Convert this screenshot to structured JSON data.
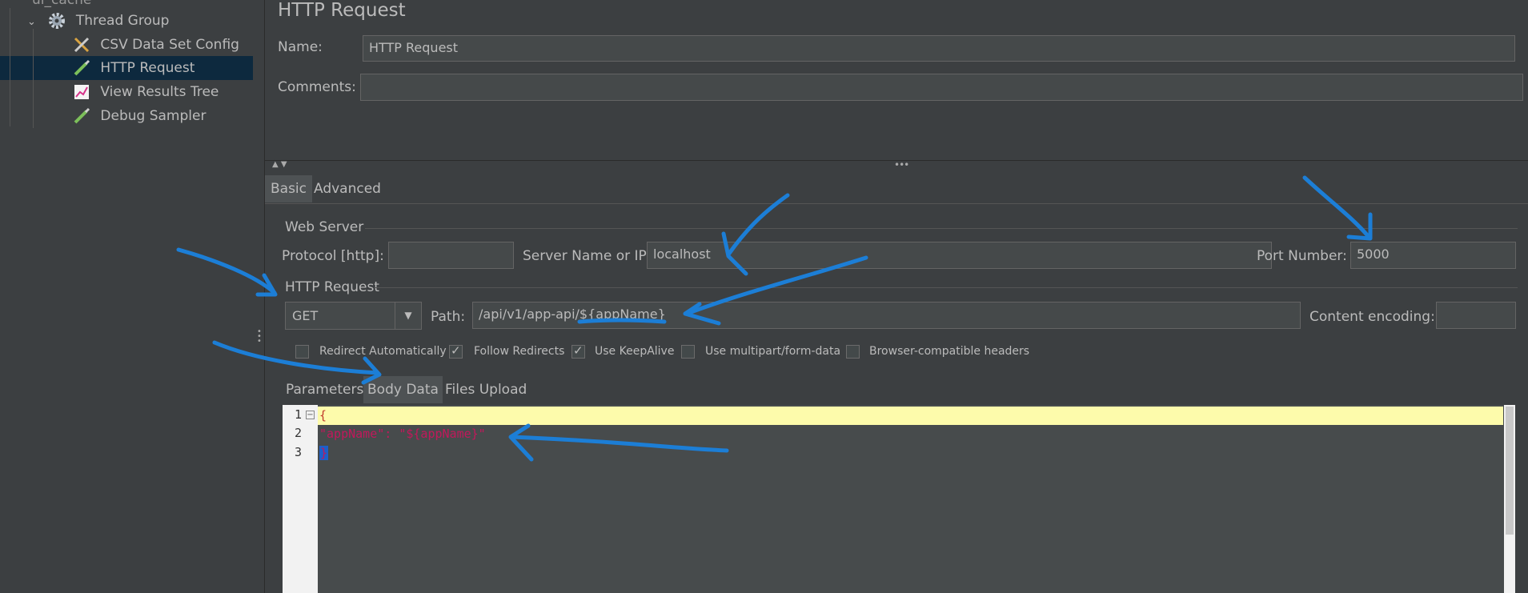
{
  "tree": {
    "top_partial": "ul_cache",
    "items": [
      {
        "label": "Thread Group",
        "icon": "gear-icon"
      },
      {
        "label": "CSV Data Set Config",
        "icon": "tools-icon"
      },
      {
        "label": "HTTP Request",
        "icon": "pipette-icon"
      },
      {
        "label": "View Results Tree",
        "icon": "chart-icon"
      },
      {
        "label": "Debug Sampler",
        "icon": "pipette-icon"
      }
    ]
  },
  "main": {
    "title": "HTTP Request",
    "name_label": "Name:",
    "name_value": "HTTP Request",
    "comments_label": "Comments:",
    "comments_value": "",
    "tabs": [
      {
        "label": "Basic"
      },
      {
        "label": "Advanced"
      }
    ],
    "web_server": {
      "title": "Web Server",
      "protocol_label": "Protocol [http]:",
      "protocol_value": "",
      "server_label": "Server Name or IP:",
      "server_value": "localhost",
      "port_label": "Port Number:",
      "port_value": "5000"
    },
    "http_request": {
      "title": "HTTP Request",
      "method": "GET",
      "path_label": "Path:",
      "path_value": "/api/v1/app-api/${appName}",
      "encoding_label": "Content encoding:",
      "encoding_value": ""
    },
    "checkboxes": [
      {
        "label": "Redirect Automatically",
        "checked": false
      },
      {
        "label": "Follow Redirects",
        "checked": true
      },
      {
        "label": "Use KeepAlive",
        "checked": true
      },
      {
        "label": "Use multipart/form-data",
        "checked": false
      },
      {
        "label": "Browser-compatible headers",
        "checked": false
      }
    ],
    "subtabs": [
      {
        "label": "Parameters"
      },
      {
        "label": "Body Data"
      },
      {
        "label": "Files Upload"
      }
    ],
    "editor": {
      "line_numbers": [
        "1",
        "2",
        "3"
      ],
      "lines": [
        "{",
        "\"appName\": \"${appName}\"",
        "}"
      ]
    }
  },
  "colors": {
    "background": "#3c3f41",
    "selection": "#0d293e",
    "annotation": "#1c7ed6",
    "json_key": "#c2185b",
    "editor_highlight": "#fdfbab"
  }
}
